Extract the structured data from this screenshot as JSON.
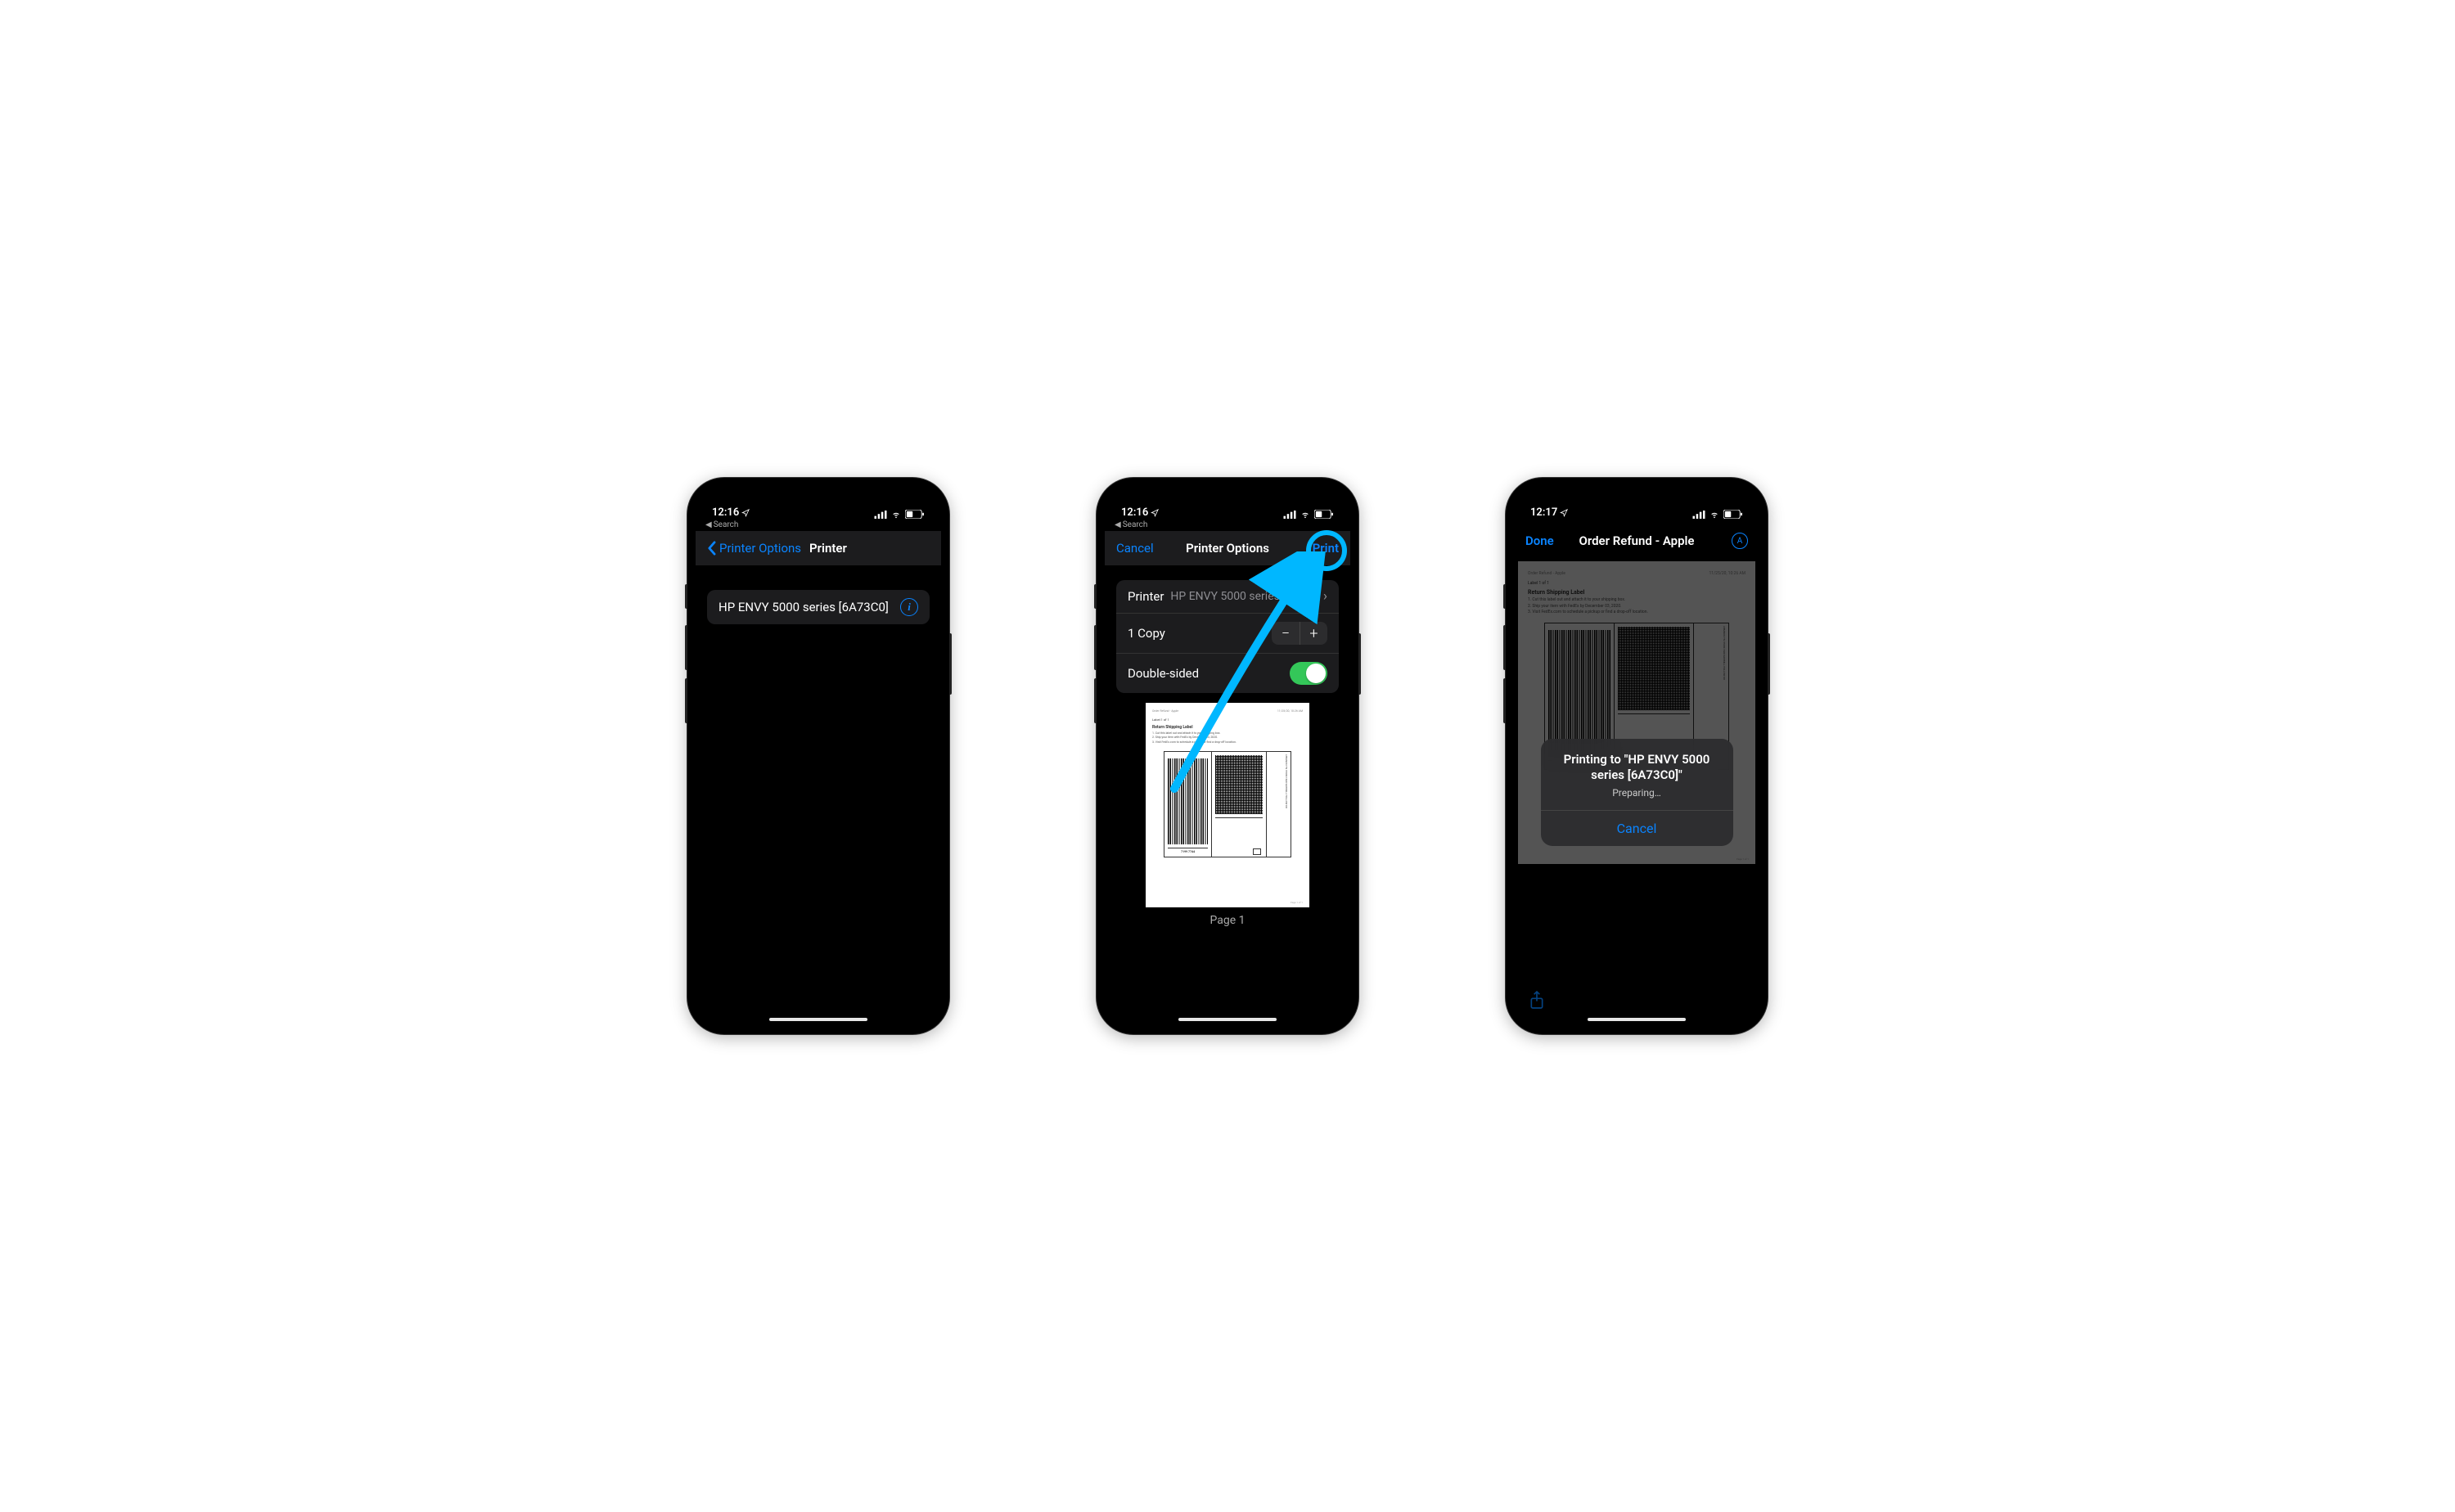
{
  "phone1": {
    "status_time": "12:16",
    "breadcrumb": "Search",
    "nav_back": "Printer Options",
    "nav_title": "Printer",
    "printer_name": "HP ENVY 5000 series [6A73C0]"
  },
  "phone2": {
    "status_time": "12:16",
    "breadcrumb": "Search",
    "nav_cancel": "Cancel",
    "nav_title": "Printer Options",
    "nav_print": "Print",
    "row_printer_label": "Printer",
    "row_printer_value": "HP ENVY 5000 series [6A73C0]",
    "row_copies": "1 Copy",
    "row_double_sided": "Double-sided",
    "page_label": "Page 1",
    "doc": {
      "header_left": "Order Refund - Apple",
      "header_right": "11/25/20, 10:26 AM",
      "label_count": "Label 1 of 1",
      "title": "Return Shipping Label",
      "step1": "1. Cut this label out and attach it to your shipping box.",
      "step2": "2. Ship your item with FedEx by December 03, 2020.",
      "step3": "3. Visit FedEx.com to schedule a pickup or find a drop-off location.",
      "tracking": "7199 7744",
      "carrier": "FedEx",
      "addr1": "LEBANON TN 37090",
      "addr2": "1620 SAWMILL HOLLOW DR",
      "footer_right": "Page 1 of 1"
    }
  },
  "phone3": {
    "status_time": "12:17",
    "nav_done": "Done",
    "nav_title": "Order Refund - Apple",
    "alert_title": "Printing to \"HP ENVY 5000 series [6A73C0]\"",
    "alert_sub": "Preparing…",
    "alert_cancel": "Cancel",
    "doc": {
      "header_left": "Order Refund - Apple",
      "header_right": "11/25/20, 10:26 AM",
      "label_count": "Label 1 of 1",
      "title": "Return Shipping Label",
      "step1": "1. Cut this label out and attach it to your shipping box.",
      "step2": "2. Ship your item with FedEx by December 03, 2020.",
      "step3": "3. Visit FedEx.com to schedule a pickup or find a drop-off location.",
      "tracking": "7199 7744",
      "addr1": "LEBANON TN 37090",
      "addr2": "1620 SAWMILL HOLLOW DR",
      "footer_right": "Page 1 of 1"
    }
  }
}
